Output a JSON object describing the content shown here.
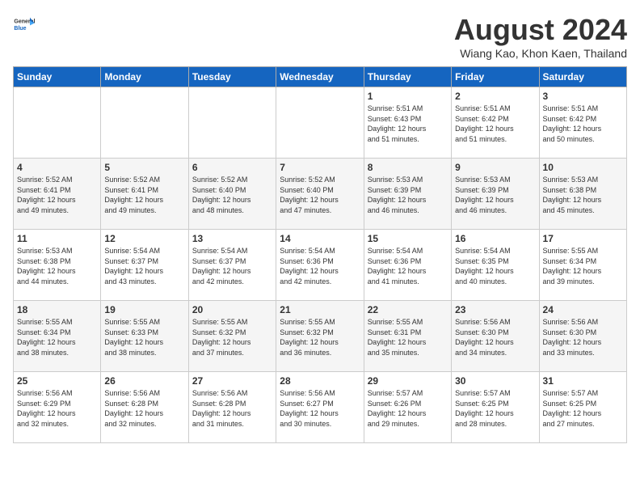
{
  "header": {
    "logo_line1": "General",
    "logo_line2": "Blue",
    "month_year": "August 2024",
    "location": "Wiang Kao, Khon Kaen, Thailand"
  },
  "days_of_week": [
    "Sunday",
    "Monday",
    "Tuesday",
    "Wednesday",
    "Thursday",
    "Friday",
    "Saturday"
  ],
  "weeks": [
    [
      {
        "day": "",
        "info": ""
      },
      {
        "day": "",
        "info": ""
      },
      {
        "day": "",
        "info": ""
      },
      {
        "day": "",
        "info": ""
      },
      {
        "day": "1",
        "info": "Sunrise: 5:51 AM\nSunset: 6:43 PM\nDaylight: 12 hours\nand 51 minutes."
      },
      {
        "day": "2",
        "info": "Sunrise: 5:51 AM\nSunset: 6:42 PM\nDaylight: 12 hours\nand 51 minutes."
      },
      {
        "day": "3",
        "info": "Sunrise: 5:51 AM\nSunset: 6:42 PM\nDaylight: 12 hours\nand 50 minutes."
      }
    ],
    [
      {
        "day": "4",
        "info": "Sunrise: 5:52 AM\nSunset: 6:41 PM\nDaylight: 12 hours\nand 49 minutes."
      },
      {
        "day": "5",
        "info": "Sunrise: 5:52 AM\nSunset: 6:41 PM\nDaylight: 12 hours\nand 49 minutes."
      },
      {
        "day": "6",
        "info": "Sunrise: 5:52 AM\nSunset: 6:40 PM\nDaylight: 12 hours\nand 48 minutes."
      },
      {
        "day": "7",
        "info": "Sunrise: 5:52 AM\nSunset: 6:40 PM\nDaylight: 12 hours\nand 47 minutes."
      },
      {
        "day": "8",
        "info": "Sunrise: 5:53 AM\nSunset: 6:39 PM\nDaylight: 12 hours\nand 46 minutes."
      },
      {
        "day": "9",
        "info": "Sunrise: 5:53 AM\nSunset: 6:39 PM\nDaylight: 12 hours\nand 46 minutes."
      },
      {
        "day": "10",
        "info": "Sunrise: 5:53 AM\nSunset: 6:38 PM\nDaylight: 12 hours\nand 45 minutes."
      }
    ],
    [
      {
        "day": "11",
        "info": "Sunrise: 5:53 AM\nSunset: 6:38 PM\nDaylight: 12 hours\nand 44 minutes."
      },
      {
        "day": "12",
        "info": "Sunrise: 5:54 AM\nSunset: 6:37 PM\nDaylight: 12 hours\nand 43 minutes."
      },
      {
        "day": "13",
        "info": "Sunrise: 5:54 AM\nSunset: 6:37 PM\nDaylight: 12 hours\nand 42 minutes."
      },
      {
        "day": "14",
        "info": "Sunrise: 5:54 AM\nSunset: 6:36 PM\nDaylight: 12 hours\nand 42 minutes."
      },
      {
        "day": "15",
        "info": "Sunrise: 5:54 AM\nSunset: 6:36 PM\nDaylight: 12 hours\nand 41 minutes."
      },
      {
        "day": "16",
        "info": "Sunrise: 5:54 AM\nSunset: 6:35 PM\nDaylight: 12 hours\nand 40 minutes."
      },
      {
        "day": "17",
        "info": "Sunrise: 5:55 AM\nSunset: 6:34 PM\nDaylight: 12 hours\nand 39 minutes."
      }
    ],
    [
      {
        "day": "18",
        "info": "Sunrise: 5:55 AM\nSunset: 6:34 PM\nDaylight: 12 hours\nand 38 minutes."
      },
      {
        "day": "19",
        "info": "Sunrise: 5:55 AM\nSunset: 6:33 PM\nDaylight: 12 hours\nand 38 minutes."
      },
      {
        "day": "20",
        "info": "Sunrise: 5:55 AM\nSunset: 6:32 PM\nDaylight: 12 hours\nand 37 minutes."
      },
      {
        "day": "21",
        "info": "Sunrise: 5:55 AM\nSunset: 6:32 PM\nDaylight: 12 hours\nand 36 minutes."
      },
      {
        "day": "22",
        "info": "Sunrise: 5:55 AM\nSunset: 6:31 PM\nDaylight: 12 hours\nand 35 minutes."
      },
      {
        "day": "23",
        "info": "Sunrise: 5:56 AM\nSunset: 6:30 PM\nDaylight: 12 hours\nand 34 minutes."
      },
      {
        "day": "24",
        "info": "Sunrise: 5:56 AM\nSunset: 6:30 PM\nDaylight: 12 hours\nand 33 minutes."
      }
    ],
    [
      {
        "day": "25",
        "info": "Sunrise: 5:56 AM\nSunset: 6:29 PM\nDaylight: 12 hours\nand 32 minutes."
      },
      {
        "day": "26",
        "info": "Sunrise: 5:56 AM\nSunset: 6:28 PM\nDaylight: 12 hours\nand 32 minutes."
      },
      {
        "day": "27",
        "info": "Sunrise: 5:56 AM\nSunset: 6:28 PM\nDaylight: 12 hours\nand 31 minutes."
      },
      {
        "day": "28",
        "info": "Sunrise: 5:56 AM\nSunset: 6:27 PM\nDaylight: 12 hours\nand 30 minutes."
      },
      {
        "day": "29",
        "info": "Sunrise: 5:57 AM\nSunset: 6:26 PM\nDaylight: 12 hours\nand 29 minutes."
      },
      {
        "day": "30",
        "info": "Sunrise: 5:57 AM\nSunset: 6:25 PM\nDaylight: 12 hours\nand 28 minutes."
      },
      {
        "day": "31",
        "info": "Sunrise: 5:57 AM\nSunset: 6:25 PM\nDaylight: 12 hours\nand 27 minutes."
      }
    ]
  ]
}
